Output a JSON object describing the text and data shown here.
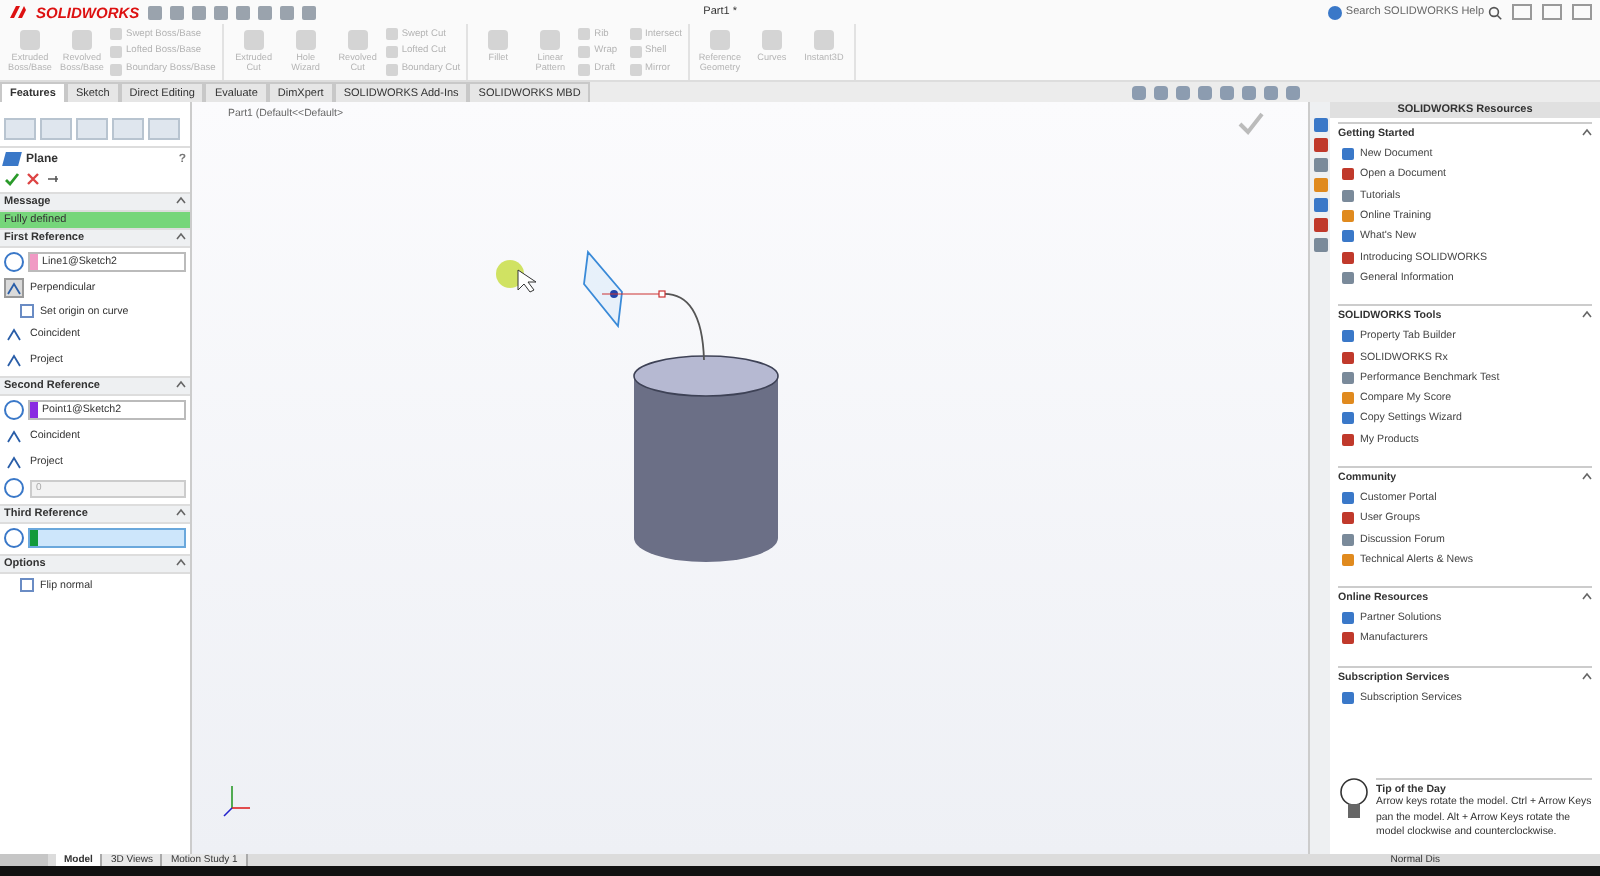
{
  "title_bar": {
    "app_name": "SOLIDWORKS",
    "document_title": "Part1 *",
    "search_placeholder": "Search SOLIDWORKS Help"
  },
  "command_groups": [
    {
      "large": [
        {
          "label": "Extruded Boss/Base",
          "disabled": true
        },
        {
          "label": "Revolved Boss/Base",
          "disabled": true
        }
      ],
      "small": [
        {
          "label": "Swept Boss/Base",
          "disabled": true
        },
        {
          "label": "Lofted Boss/Base",
          "disabled": true
        },
        {
          "label": "Boundary Boss/Base",
          "disabled": true
        }
      ]
    },
    {
      "large": [
        {
          "label": "Extruded Cut",
          "disabled": true
        },
        {
          "label": "Hole Wizard",
          "disabled": true
        },
        {
          "label": "Revolved Cut",
          "disabled": true
        }
      ],
      "small": [
        {
          "label": "Swept Cut",
          "disabled": true
        },
        {
          "label": "Lofted Cut",
          "disabled": true
        },
        {
          "label": "Boundary Cut",
          "disabled": true
        }
      ]
    },
    {
      "large": [
        {
          "label": "Fillet",
          "disabled": true
        },
        {
          "label": "Linear Pattern",
          "disabled": true
        }
      ],
      "small": [
        {
          "label": "Rib",
          "disabled": true
        },
        {
          "label": "Wrap",
          "disabled": true
        },
        {
          "label": "Draft",
          "disabled": true
        },
        {
          "label": "Intersect",
          "disabled": true
        },
        {
          "label": "Shell",
          "disabled": true
        },
        {
          "label": "Mirror",
          "disabled": true
        }
      ]
    },
    {
      "large": [
        {
          "label": "Reference Geometry",
          "disabled": true
        },
        {
          "label": "Curves",
          "disabled": true
        },
        {
          "label": "Instant3D",
          "disabled": true
        }
      ]
    }
  ],
  "tabs": [
    {
      "label": "Features",
      "selected": true
    },
    {
      "label": "Sketch",
      "selected": false
    },
    {
      "label": "Direct Editing",
      "selected": false
    },
    {
      "label": "Evaluate",
      "selected": false
    },
    {
      "label": "DimXpert",
      "selected": false
    },
    {
      "label": "SOLIDWORKS Add-Ins",
      "selected": false
    },
    {
      "label": "SOLIDWORKS MBD",
      "selected": false
    }
  ],
  "property_manager": {
    "title": "Plane",
    "help": "?",
    "sections": [
      {
        "title": "Message",
        "kind": "message",
        "text": "Fully defined"
      },
      {
        "title": "First Reference",
        "kind": "reference",
        "selection": "Line1@Sketch2",
        "color": "#f09ac4",
        "active": false,
        "options": [
          {
            "kind": "toggle",
            "label": "Perpendicular",
            "selected": true
          },
          {
            "kind": "checkbox",
            "label": "Set origin on curve",
            "checked": false
          },
          {
            "kind": "toggle",
            "label": "Coincident",
            "selected": false
          },
          {
            "kind": "toggle",
            "label": "Project",
            "selected": false
          }
        ]
      },
      {
        "title": "Second Reference",
        "kind": "reference",
        "selection": "Point1@Sketch2",
        "color": "#8a2be2",
        "active": false,
        "options": [
          {
            "kind": "toggle",
            "label": "Coincident",
            "selected": false
          },
          {
            "kind": "toggle",
            "label": "Project",
            "selected": false
          },
          {
            "kind": "number",
            "value": "0",
            "disabled": true
          }
        ]
      },
      {
        "title": "Third Reference",
        "kind": "reference",
        "color": "#139a3a",
        "active": true
      },
      {
        "title": "Options",
        "kind": "options",
        "options": [
          {
            "kind": "checkbox",
            "label": "Flip normal",
            "checked": false
          }
        ]
      }
    ]
  },
  "viewport": {
    "tree_label": "Part1 (Default<<Default>"
  },
  "task_pane": {
    "title": "SOLIDWORKS Resources",
    "sections": [
      {
        "title": "Getting Started",
        "items": [
          "New Document",
          "Open a Document",
          "Tutorials",
          "Online Training",
          "What's New",
          "Introducing SOLIDWORKS",
          "General Information"
        ]
      },
      {
        "title": "SOLIDWORKS Tools",
        "items": [
          "Property Tab Builder",
          "SOLIDWORKS Rx",
          "Performance Benchmark Test",
          "Compare My Score",
          "Copy Settings Wizard",
          "My Products"
        ]
      },
      {
        "title": "Community",
        "items": [
          "Customer Portal",
          "User Groups",
          "Discussion Forum",
          "Technical Alerts & News"
        ]
      },
      {
        "title": "Online Resources",
        "items": [
          "Partner Solutions",
          "Manufacturers"
        ]
      },
      {
        "title": "Subscription Services",
        "items": [
          "Subscription Services"
        ]
      }
    ],
    "tip": {
      "title": "Tip of the Day",
      "text": "Arrow keys rotate the model. Ctrl + Arrow Keys pan the model. Alt + Arrow Keys rotate the model clockwise and counterclockwise."
    }
  },
  "bottom_tabs": [
    {
      "label": "Model",
      "selected": true
    },
    {
      "label": "3D Views",
      "selected": false
    },
    {
      "label": "Motion Study 1",
      "selected": false
    }
  ],
  "status_bar": {
    "text": "Normal Dis"
  }
}
